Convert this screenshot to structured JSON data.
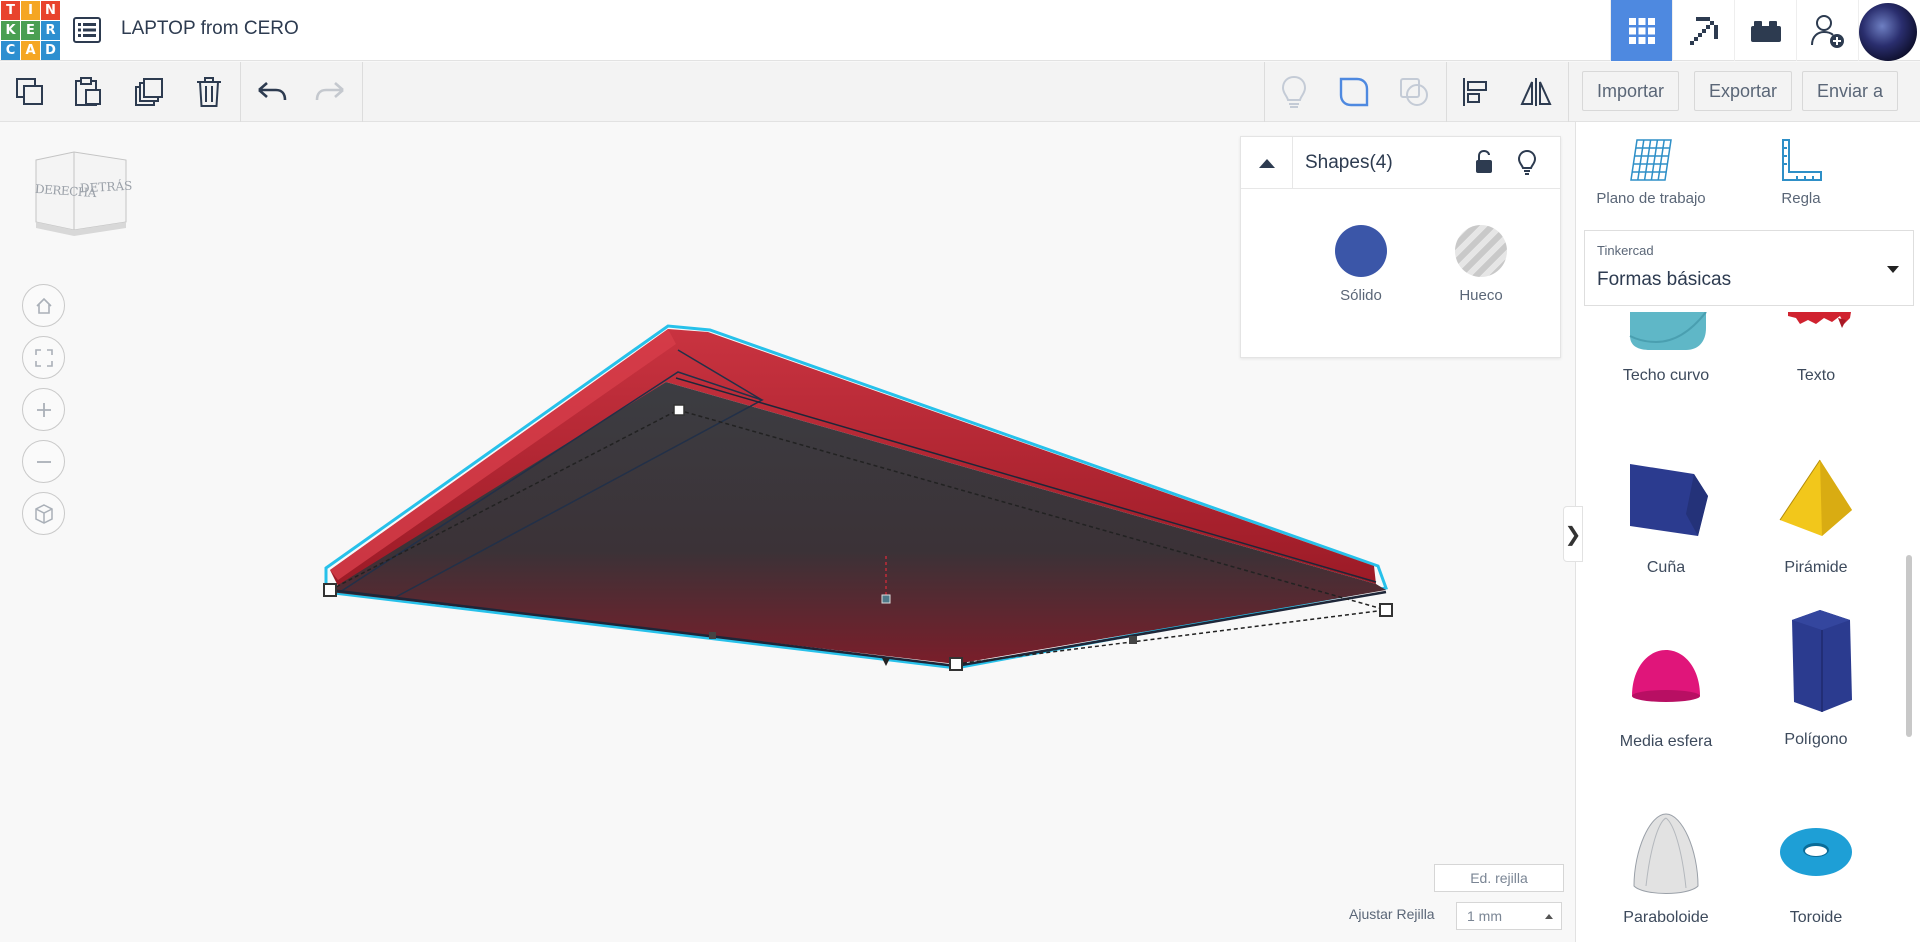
{
  "app": {
    "logo_letters": [
      "T",
      "I",
      "N",
      "K",
      "E",
      "R",
      "C",
      "A",
      "D"
    ],
    "logo_colors": [
      "#e8432d",
      "#f5a623",
      "#e8432d",
      "#4a9f52",
      "#4a9f52",
      "#2d8fd0",
      "#2d8fd0",
      "#f5a623",
      "#2d8fd0"
    ],
    "project_title": "LAPTOP from CERO"
  },
  "top_nav": {
    "icons": [
      "grid-view-icon",
      "pickaxe-icon",
      "bricks-icon",
      "add-user-icon"
    ],
    "active": "grid-view-icon",
    "accent_color": "#4e89e0"
  },
  "toolbar": {
    "icons": [
      "copy-icon",
      "paste-icon",
      "duplicate-icon",
      "delete-icon",
      "undo-icon",
      "redo-icon",
      "bulb-icon",
      "solid-shape-icon",
      "hole-shape-icon",
      "align-icon",
      "mirror-icon"
    ],
    "import_label": "Importar",
    "export_label": "Exportar",
    "send_label": "Enviar a"
  },
  "viewcube": {
    "face_right": "DERECHA",
    "face_back": "DETRÁS"
  },
  "shapes_panel": {
    "title": "Shapes(4)",
    "solid_label": "Sólido",
    "hole_label": "Hueco",
    "solid_color": "#3b56a8"
  },
  "grid": {
    "edit_label": "Ed. rejilla",
    "snap_label": "Ajustar Rejilla",
    "snap_value": "1 mm"
  },
  "sidebar": {
    "workplane_label": "Plano de trabajo",
    "ruler_label": "Regla",
    "library_source": "Tinkercad",
    "library_value": "Formas básicas",
    "shapes": [
      {
        "name": "Techo curvo",
        "color": "#5fb7c7"
      },
      {
        "name": "Texto",
        "color": "#d0222f"
      },
      {
        "name": "Cuña",
        "color": "#2b3b8f"
      },
      {
        "name": "Pirámide",
        "color": "#f2c71b"
      },
      {
        "name": "Media esfera",
        "color": "#e0157a"
      },
      {
        "name": "Polígono",
        "color": "#2b3b8f"
      },
      {
        "name": "Paraboloide",
        "color": "#d9d9d9"
      },
      {
        "name": "Toroide",
        "color": "#1e9fd6"
      }
    ]
  }
}
